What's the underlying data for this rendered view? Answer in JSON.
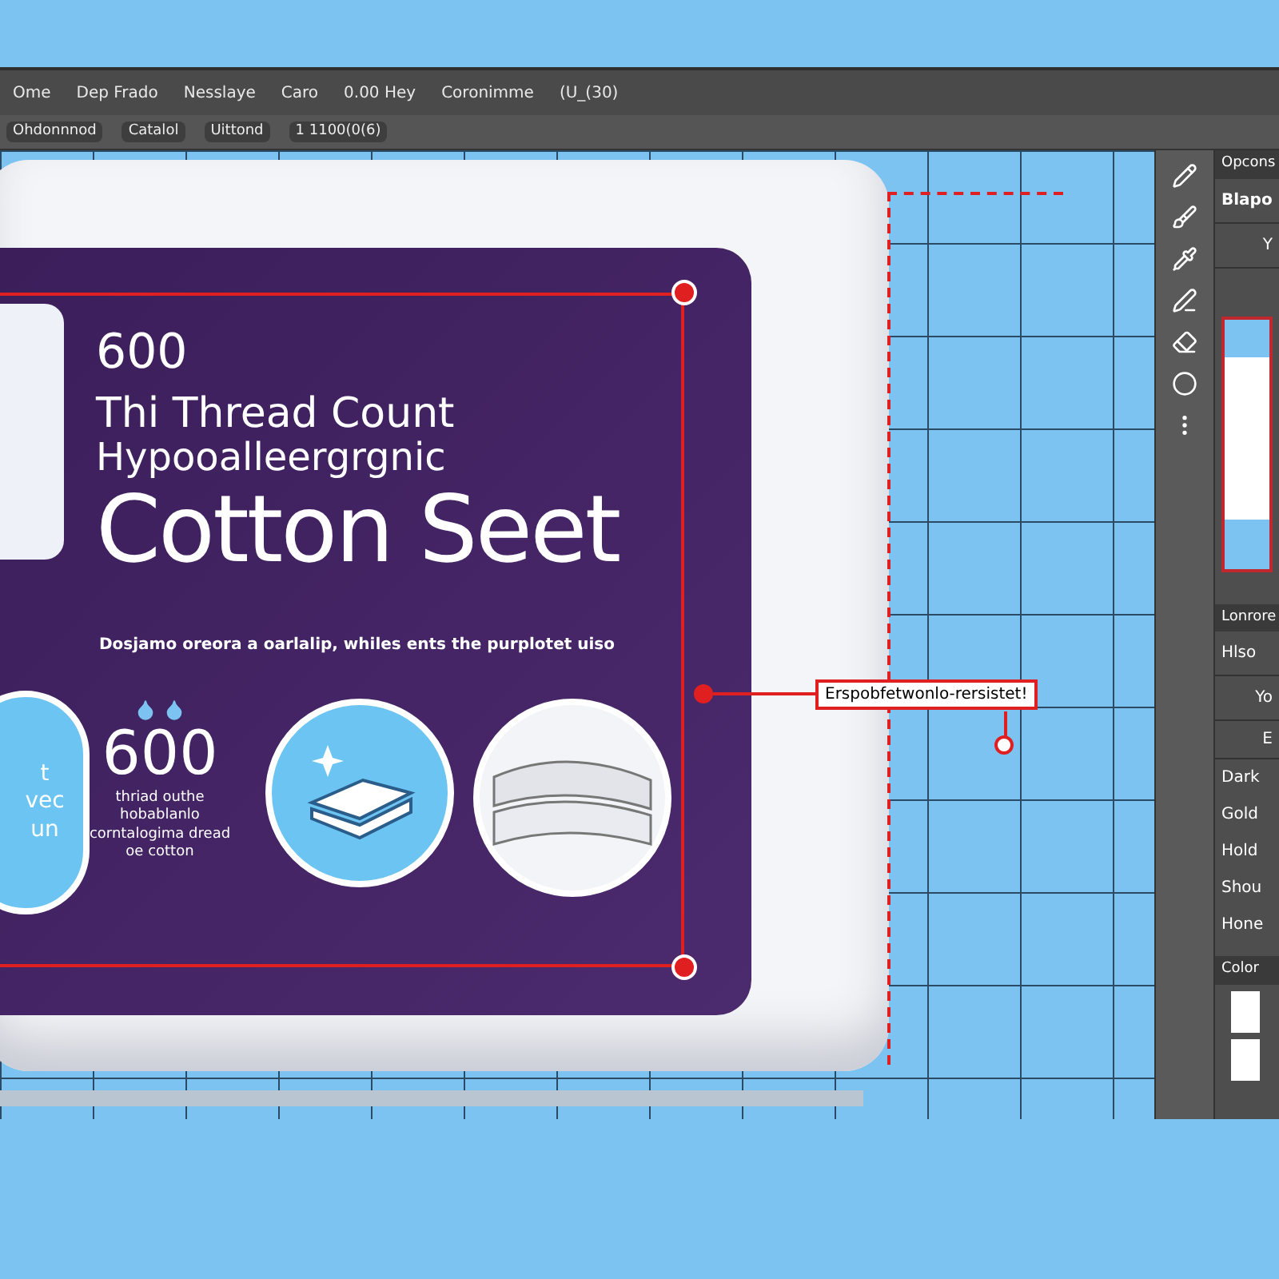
{
  "menu_bar": {
    "items": [
      "Ome",
      "Dep Frado",
      "Nesslaye",
      "Caro",
      "0.00 Hey",
      "Coronimme",
      "(U_(30)"
    ]
  },
  "options_bar": {
    "items": [
      "Ohdonnnod",
      "Catalol",
      "Uittond",
      "1 1100(0(6)"
    ]
  },
  "artboard": {
    "number": "600",
    "line_1": "Thi Thread Count",
    "line_2": "Hypooalleergrgnic",
    "title": "Cotton Seet",
    "tagline": "Dosjamo oreora a oarlalip, whiles ents the purplotet uiso",
    "left_badge": [
      "t",
      "vec",
      "un"
    ],
    "count": "600",
    "count_caption": "thriad outhe hobablanlo corntalogima dread oe cotton",
    "callout": "Erspobfetwonlo-rersistet!"
  },
  "right_panel": {
    "header": "Opcons",
    "field_1": "Blapo",
    "field_2": "Y",
    "section": "Lonrore",
    "row_1": "Hlso",
    "row_2": "Yo",
    "row_3": "E",
    "list": [
      "Dark",
      "Gold",
      "Hold",
      "Shou",
      "Hone"
    ],
    "swatches_title": "Color"
  }
}
